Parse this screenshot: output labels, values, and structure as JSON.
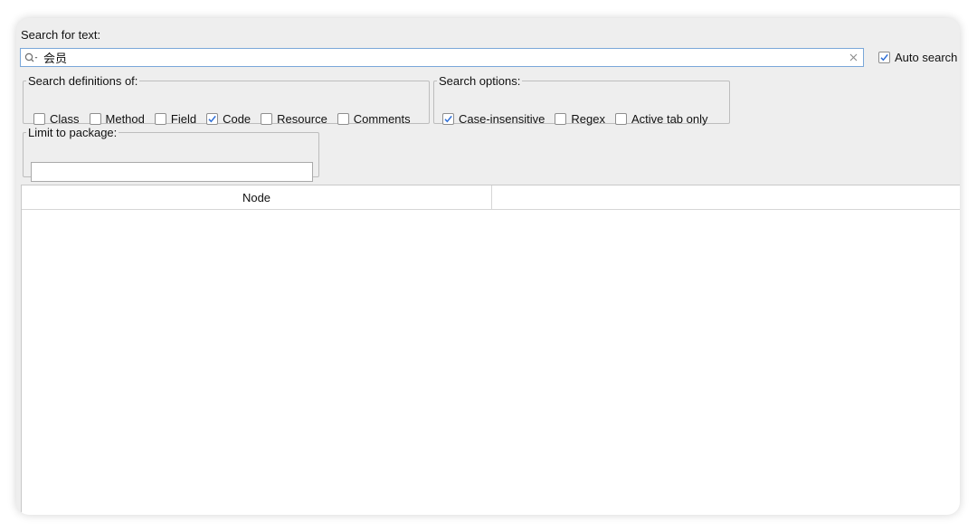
{
  "search": {
    "label": "Search for text:",
    "value": "会员",
    "placeholder": ""
  },
  "auto_search": {
    "label": "Auto search",
    "checked": true
  },
  "definitions": {
    "legend": "Search definitions of:",
    "options": [
      {
        "label": "Class",
        "checked": false
      },
      {
        "label": "Method",
        "checked": false
      },
      {
        "label": "Field",
        "checked": false
      },
      {
        "label": "Code",
        "checked": true
      },
      {
        "label": "Resource",
        "checked": false
      },
      {
        "label": "Comments",
        "checked": false
      }
    ]
  },
  "search_options": {
    "legend": "Search options:",
    "options": [
      {
        "label": "Case-insensitive",
        "checked": true
      },
      {
        "label": "Regex",
        "checked": false
      },
      {
        "label": "Active tab only",
        "checked": false
      }
    ]
  },
  "package": {
    "legend": "Limit to package:",
    "value": ""
  },
  "results": {
    "columns": [
      "Node",
      ""
    ]
  },
  "colors": {
    "window_bg": "#eeeeee",
    "accent": "#2f6fd6",
    "input_focus_border": "#7aa7d9"
  }
}
